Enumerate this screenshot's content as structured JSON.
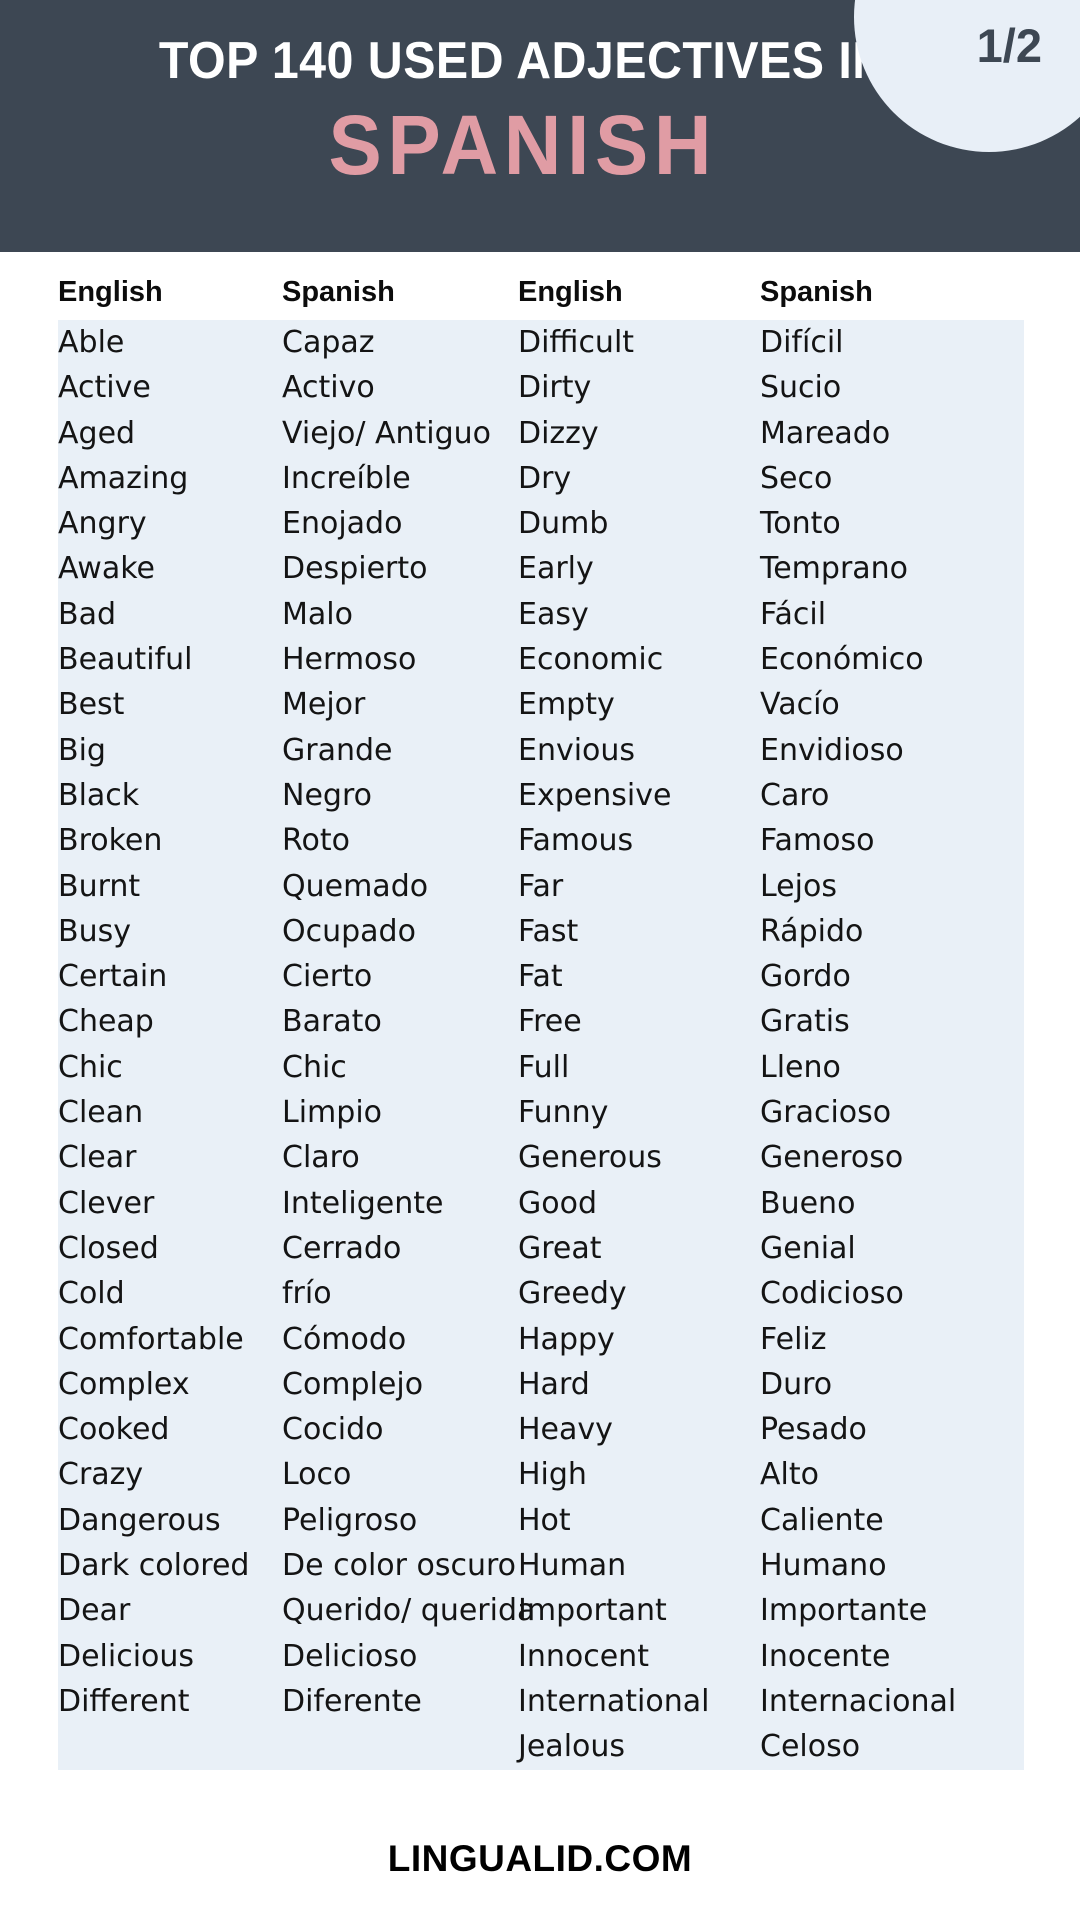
{
  "header": {
    "title_line1": "TOP 140 USED ADJECTIVES IN",
    "title_line2": "SPANISH",
    "page_badge": "1/2",
    "bg_color": "#3d4753",
    "accent_color": "#e09ca4",
    "badge_bg_color": "#e8eff7"
  },
  "table": {
    "row_bg_color": "#e9f0f7",
    "headers": [
      "English",
      "Spanish",
      "English",
      "Spanish"
    ],
    "left_pairs": [
      [
        "Able",
        "Capaz"
      ],
      [
        "Active",
        "Activo"
      ],
      [
        "Aged",
        "Viejo/ Antiguo"
      ],
      [
        "Amazing",
        "Increíble"
      ],
      [
        "Angry",
        "Enojado"
      ],
      [
        "Awake",
        "Despierto"
      ],
      [
        "Bad",
        "Malo"
      ],
      [
        "Beautiful",
        "Hermoso"
      ],
      [
        "Best",
        "Mejor"
      ],
      [
        "Big",
        "Grande"
      ],
      [
        "Black",
        "Negro"
      ],
      [
        "Broken",
        "Roto"
      ],
      [
        "Burnt",
        "Quemado"
      ],
      [
        "Busy",
        "Ocupado"
      ],
      [
        "Certain",
        "Cierto"
      ],
      [
        "Cheap",
        "Barato"
      ],
      [
        "Chic",
        "Chic"
      ],
      [
        "Clean",
        "Limpio"
      ],
      [
        "Clear",
        "Claro"
      ],
      [
        "Clever",
        "Inteligente"
      ],
      [
        "Closed",
        "Cerrado"
      ],
      [
        "Cold",
        "frío"
      ],
      [
        "Comfortable",
        "Cómodo"
      ],
      [
        "Complex",
        "Complejo"
      ],
      [
        "Cooked",
        "Cocido"
      ],
      [
        "Crazy",
        "Loco"
      ],
      [
        "Dangerous",
        "Peligroso"
      ],
      [
        "Dark colored",
        "De color oscuro"
      ],
      [
        "Dear",
        "Querido/ querida"
      ],
      [
        "Delicious",
        "Delicioso"
      ],
      [
        "Different",
        "Diferente"
      ]
    ],
    "right_pairs": [
      [
        "Difficult",
        "Difícil"
      ],
      [
        "Dirty",
        "Sucio"
      ],
      [
        "Dizzy",
        "Mareado"
      ],
      [
        "Dry",
        "Seco"
      ],
      [
        "Dumb",
        "Tonto"
      ],
      [
        "Early",
        "Temprano"
      ],
      [
        "Easy",
        "Fácil"
      ],
      [
        "Economic",
        "Económico"
      ],
      [
        "Empty",
        "Vacío"
      ],
      [
        "Envious",
        "Envidioso"
      ],
      [
        "Expensive",
        "Caro"
      ],
      [
        "Famous",
        "Famoso"
      ],
      [
        "Far",
        "Lejos"
      ],
      [
        "Fast",
        "Rápido"
      ],
      [
        "Fat",
        "Gordo"
      ],
      [
        "Free",
        "Gratis"
      ],
      [
        "Full",
        "Lleno"
      ],
      [
        "Funny",
        "Gracioso"
      ],
      [
        "Generous",
        "Generoso"
      ],
      [
        "Good",
        "Bueno"
      ],
      [
        "Great",
        "Genial"
      ],
      [
        "Greedy",
        "Codicioso"
      ],
      [
        "Happy",
        "Feliz"
      ],
      [
        "Hard",
        "Duro"
      ],
      [
        "Heavy",
        "Pesado"
      ],
      [
        "High",
        "Alto"
      ],
      [
        "Hot",
        "Caliente"
      ],
      [
        "Human",
        "Humano"
      ],
      [
        "Important",
        "Importante"
      ],
      [
        "Innocent",
        "Inocente"
      ],
      [
        "International",
        "Internacional"
      ],
      [
        "Jealous",
        "Celoso"
      ]
    ]
  },
  "footer": {
    "site": "LINGUALID.COM"
  }
}
